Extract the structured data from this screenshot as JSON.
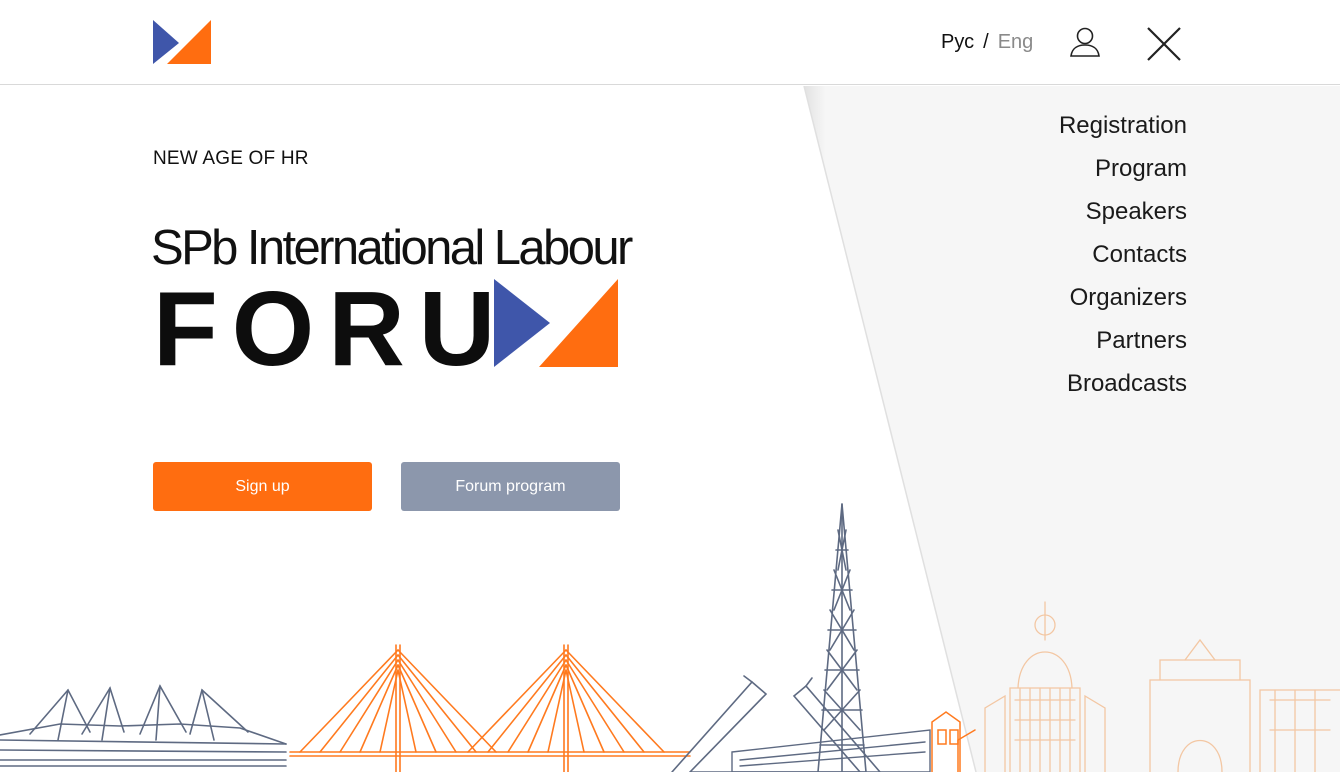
{
  "header": {
    "lang_ru": "Рус",
    "lang_sep": "/",
    "lang_en": "Eng"
  },
  "nav": {
    "items": [
      "Registration",
      "Program",
      "Speakers",
      "Contacts",
      "Organizers",
      "Partners",
      "Broadcasts"
    ]
  },
  "hero": {
    "tagline": "NEW AGE OF HR",
    "title_line1": "SPb International Labour",
    "title_line2": "FORU"
  },
  "buttons": {
    "signup": "Sign up",
    "program": "Forum program"
  },
  "colors": {
    "brand_orange": "#ff6d10",
    "brand_blue": "#3f56aa",
    "button_gray": "#8c97ac",
    "panel_bg": "#f6f6f6",
    "skyline_gray": "#5e6a82"
  },
  "icons": [
    "logo-icon",
    "user-icon",
    "close-icon",
    "skyline-illustration"
  ]
}
